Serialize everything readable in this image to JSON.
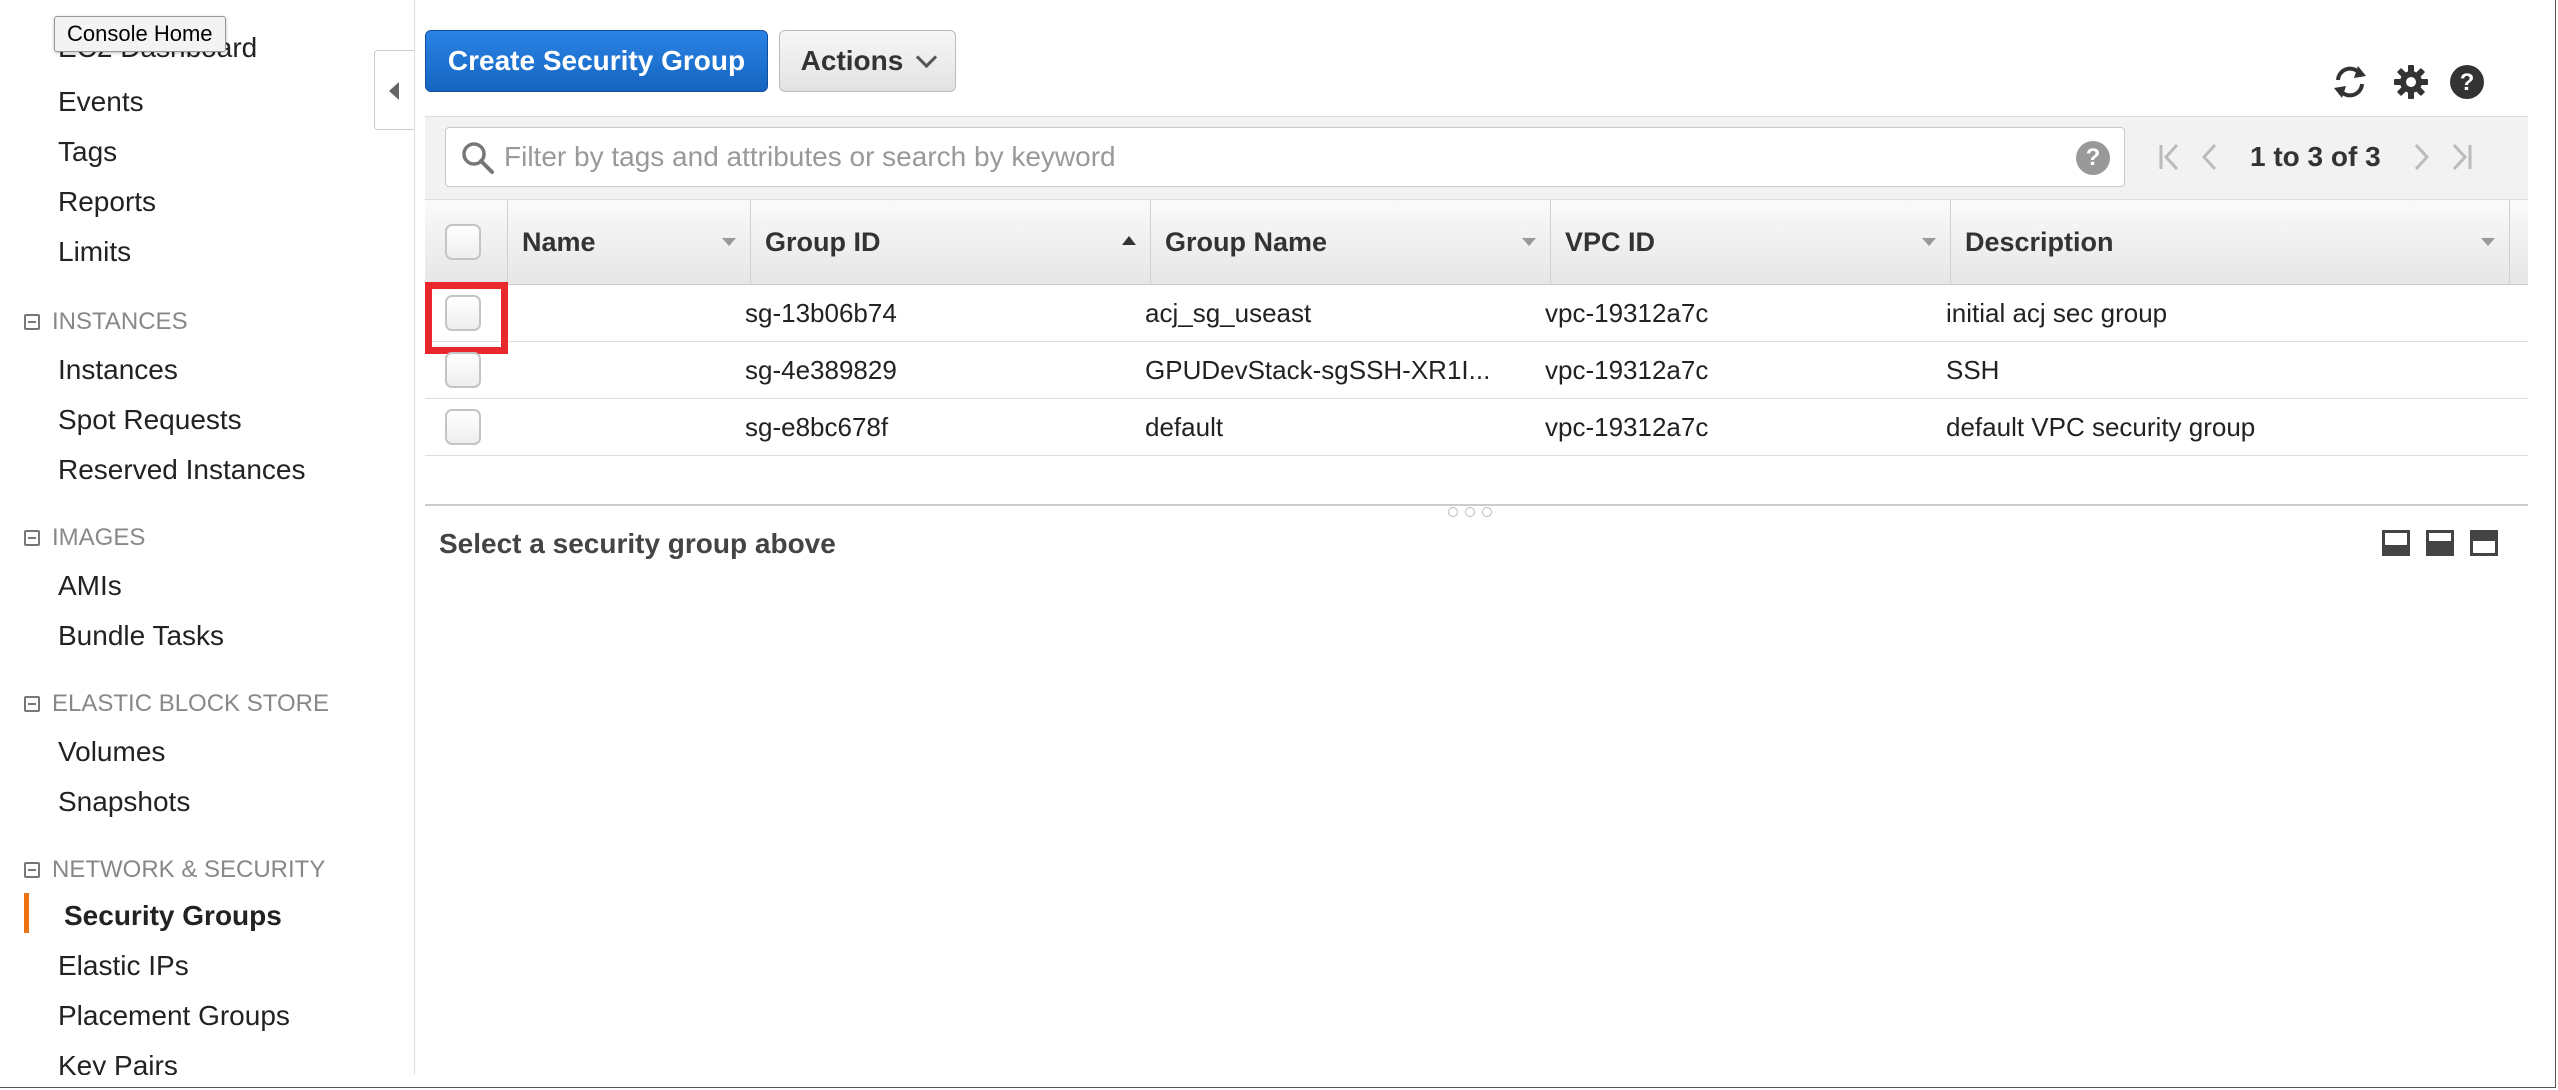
{
  "tooltip": "Console Home",
  "sidebar": {
    "items_top": [
      {
        "label": "EC2 Dashboard"
      },
      {
        "label": "Events"
      },
      {
        "label": "Tags"
      },
      {
        "label": "Reports"
      },
      {
        "label": "Limits"
      }
    ],
    "sections": [
      {
        "title": "INSTANCES",
        "items": [
          "Instances",
          "Spot Requests",
          "Reserved Instances"
        ]
      },
      {
        "title": "IMAGES",
        "items": [
          "AMIs",
          "Bundle Tasks"
        ]
      },
      {
        "title": "ELASTIC BLOCK STORE",
        "items": [
          "Volumes",
          "Snapshots"
        ]
      },
      {
        "title": "NETWORK & SECURITY",
        "items": [
          "Security Groups",
          "Elastic IPs",
          "Placement Groups",
          "Key Pairs"
        ]
      }
    ],
    "active_item": "Security Groups"
  },
  "toolbar": {
    "create_label": "Create Security Group",
    "actions_label": "Actions"
  },
  "filter": {
    "placeholder": "Filter by tags and attributes or search by keyword",
    "help": "?",
    "pager_text": "1 to 3 of 3"
  },
  "table": {
    "columns": [
      "Name",
      "Group ID",
      "Group Name",
      "VPC ID",
      "Description"
    ],
    "sorted_column": "Group ID",
    "rows": [
      {
        "name": "",
        "group_id": "sg-13b06b74",
        "group_name": "acj_sg_useast",
        "vpc_id": "vpc-19312a7c",
        "description": "initial acj sec group"
      },
      {
        "name": "",
        "group_id": "sg-4e389829",
        "group_name": "GPUDevStack-sgSSH-XR1I...",
        "vpc_id": "vpc-19312a7c",
        "description": "SSH"
      },
      {
        "name": "",
        "group_id": "sg-e8bc678f",
        "group_name": "default",
        "vpc_id": "vpc-19312a7c",
        "description": "default VPC security group"
      }
    ]
  },
  "detail": {
    "title": "Select a security group above"
  },
  "colors": {
    "primary": "#1e73d6",
    "active_bar": "#ec7211",
    "highlight": "#e8282c"
  }
}
